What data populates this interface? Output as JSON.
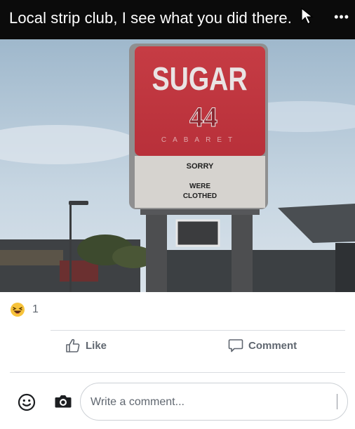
{
  "post": {
    "caption": "Local strip club, I see what you did there."
  },
  "photo": {
    "sign_title": "SUGAR",
    "sign_number": "44",
    "sign_subtitle": "CABARET",
    "marquee_line1": "SORRY",
    "marquee_line2": "WERE",
    "marquee_line3": "CLOTHED",
    "colors": {
      "sign_red": "#c8393f",
      "sign_grey": "#d5d2ce",
      "sky": "#b9cfe0"
    }
  },
  "reactions": {
    "icon": "haha-emoji-icon",
    "count": "1"
  },
  "actions": {
    "like_label": "Like",
    "comment_label": "Comment"
  },
  "composer": {
    "placeholder": "Write a comment..."
  },
  "colors": {
    "caption_bar": "#0b0b0b",
    "action_text": "#606770"
  }
}
